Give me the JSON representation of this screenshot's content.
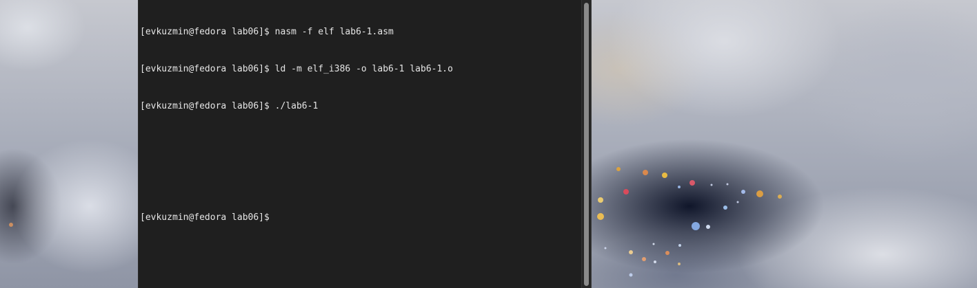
{
  "terminal": {
    "lines": [
      "[evkuzmin@fedora lab06]$ nasm -f elf lab6-1.asm",
      "[evkuzmin@fedora lab06]$ ld -m elf_i386 -o lab6-1 lab6-1.o",
      "[evkuzmin@fedora lab06]$ ./lab6-1",
      "",
      "",
      "[evkuzmin@fedora lab06]$"
    ]
  },
  "colors": {
    "terminal_bg": "#1f1f1f",
    "terminal_fg": "#e6e6e6",
    "scrollbar_thumb": "#8a8a8a"
  }
}
